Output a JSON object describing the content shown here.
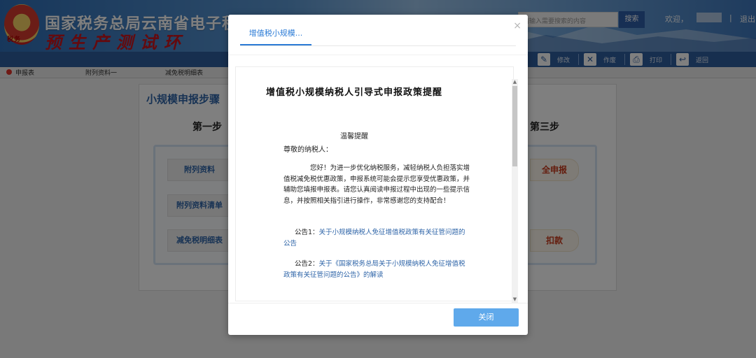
{
  "header": {
    "site_title": "国家税务总局云南省电子税务",
    "site_subtitle": "预生产测试环",
    "search_placeholder": "请输入需要搜索的内容",
    "search_button": "搜索",
    "welcome": "欢迎，",
    "separator": "|",
    "logout": "退出"
  },
  "toolbar": {
    "items": [
      {
        "label": "修改",
        "icon": "pencil-icon"
      },
      {
        "label": "作废",
        "icon": "void-doc-icon"
      },
      {
        "label": "打印",
        "icon": "printer-icon"
      },
      {
        "label": "返回",
        "icon": "back-arrow-icon"
      }
    ]
  },
  "tabs": [
    "申报表",
    "附列资料一",
    "减免税明细表"
  ],
  "main": {
    "steps_title": "小规模申报步骤",
    "step1": "第一步",
    "step3": "第三步",
    "left_buttons": [
      "附列资料",
      "附列资料清单",
      "减免税明细表"
    ],
    "right_buttons": [
      "全申报",
      "扣款"
    ]
  },
  "modal": {
    "tab_label": "增值税小规模...",
    "close_x": "×",
    "doc_title": "增值税小规模纳税人引导式申报政策提醒",
    "doc_subtitle": "温馨提醒",
    "greeting": "尊敬的纳税人：",
    "paragraph": "您好！为进一步优化纳税服务，减轻纳税人负担落实增值税减免税优惠政策，申报系统可能会提示您享受优惠政策，并辅助您填报申报表。请您认真阅读申报过程中出现的一些提示信息，并按照相关指引进行操作，非常感谢您的支持配合！",
    "notice1_prefix": "公告1：",
    "notice1_link": "关于小规模纳税人免征增值税政策有关征管问题的公告",
    "notice2_prefix": "公告2：",
    "notice2_link": "关于《国家税务总局关于小规模纳税人免征增值税政策有关征管问题的公告》的解读",
    "close_button": "关闭"
  },
  "colors": {
    "brand_blue": "#2f5f9e",
    "link_blue": "#2f65a8",
    "primary_button": "#5fa9eb",
    "accent_red": "#c8151d"
  }
}
